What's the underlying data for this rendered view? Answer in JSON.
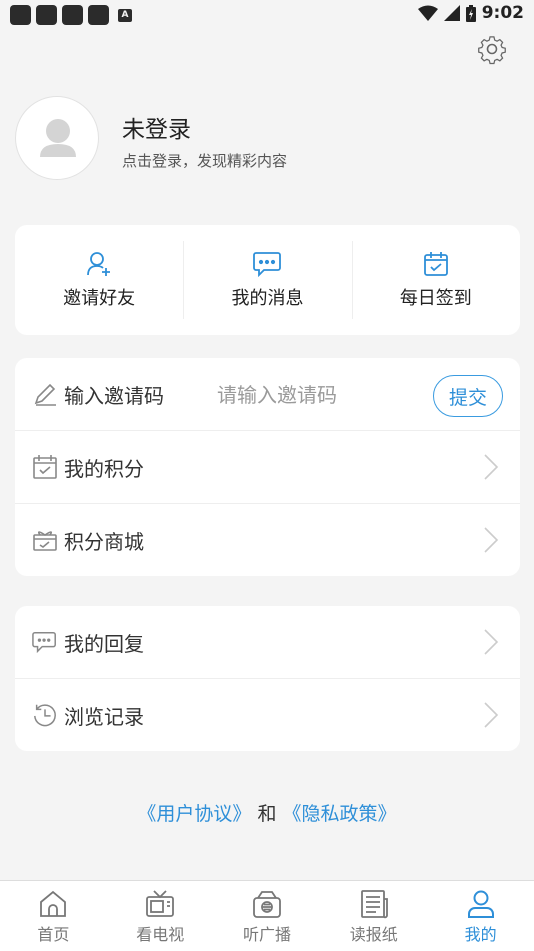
{
  "status_bar": {
    "time": "9:02",
    "notification_letter": "A"
  },
  "profile": {
    "title": "未登录",
    "subtitle": "点击登录，发现精彩内容"
  },
  "quick_actions": [
    {
      "label": "邀请好友",
      "icon": "add-user-icon"
    },
    {
      "label": "我的消息",
      "icon": "message-icon"
    },
    {
      "label": "每日签到",
      "icon": "calendar-check-icon"
    }
  ],
  "invite": {
    "label": "输入邀请码",
    "placeholder": "请输入邀请码",
    "value": "",
    "submit_label": "提交"
  },
  "menu_group_1": [
    {
      "label": "我的积分",
      "icon": "points-calendar-icon"
    },
    {
      "label": "积分商城",
      "icon": "gift-box-icon"
    }
  ],
  "menu_group_2": [
    {
      "label": "我的回复",
      "icon": "reply-bubble-icon"
    },
    {
      "label": "浏览记录",
      "icon": "history-clock-icon"
    }
  ],
  "footer": {
    "user_agreement": "《用户协议》",
    "and": "和",
    "privacy_policy": "《隐私政策》"
  },
  "tabs": [
    {
      "label": "首页",
      "icon": "home-icon",
      "active": false
    },
    {
      "label": "看电视",
      "icon": "tv-icon",
      "active": false
    },
    {
      "label": "听广播",
      "icon": "radio-icon",
      "active": false
    },
    {
      "label": "读报纸",
      "icon": "newspaper-icon",
      "active": false
    },
    {
      "label": "我的",
      "icon": "user-icon",
      "active": true
    }
  ],
  "colors": {
    "accent": "#2e8fd8",
    "background": "#f4f4f4",
    "card": "#ffffff"
  }
}
